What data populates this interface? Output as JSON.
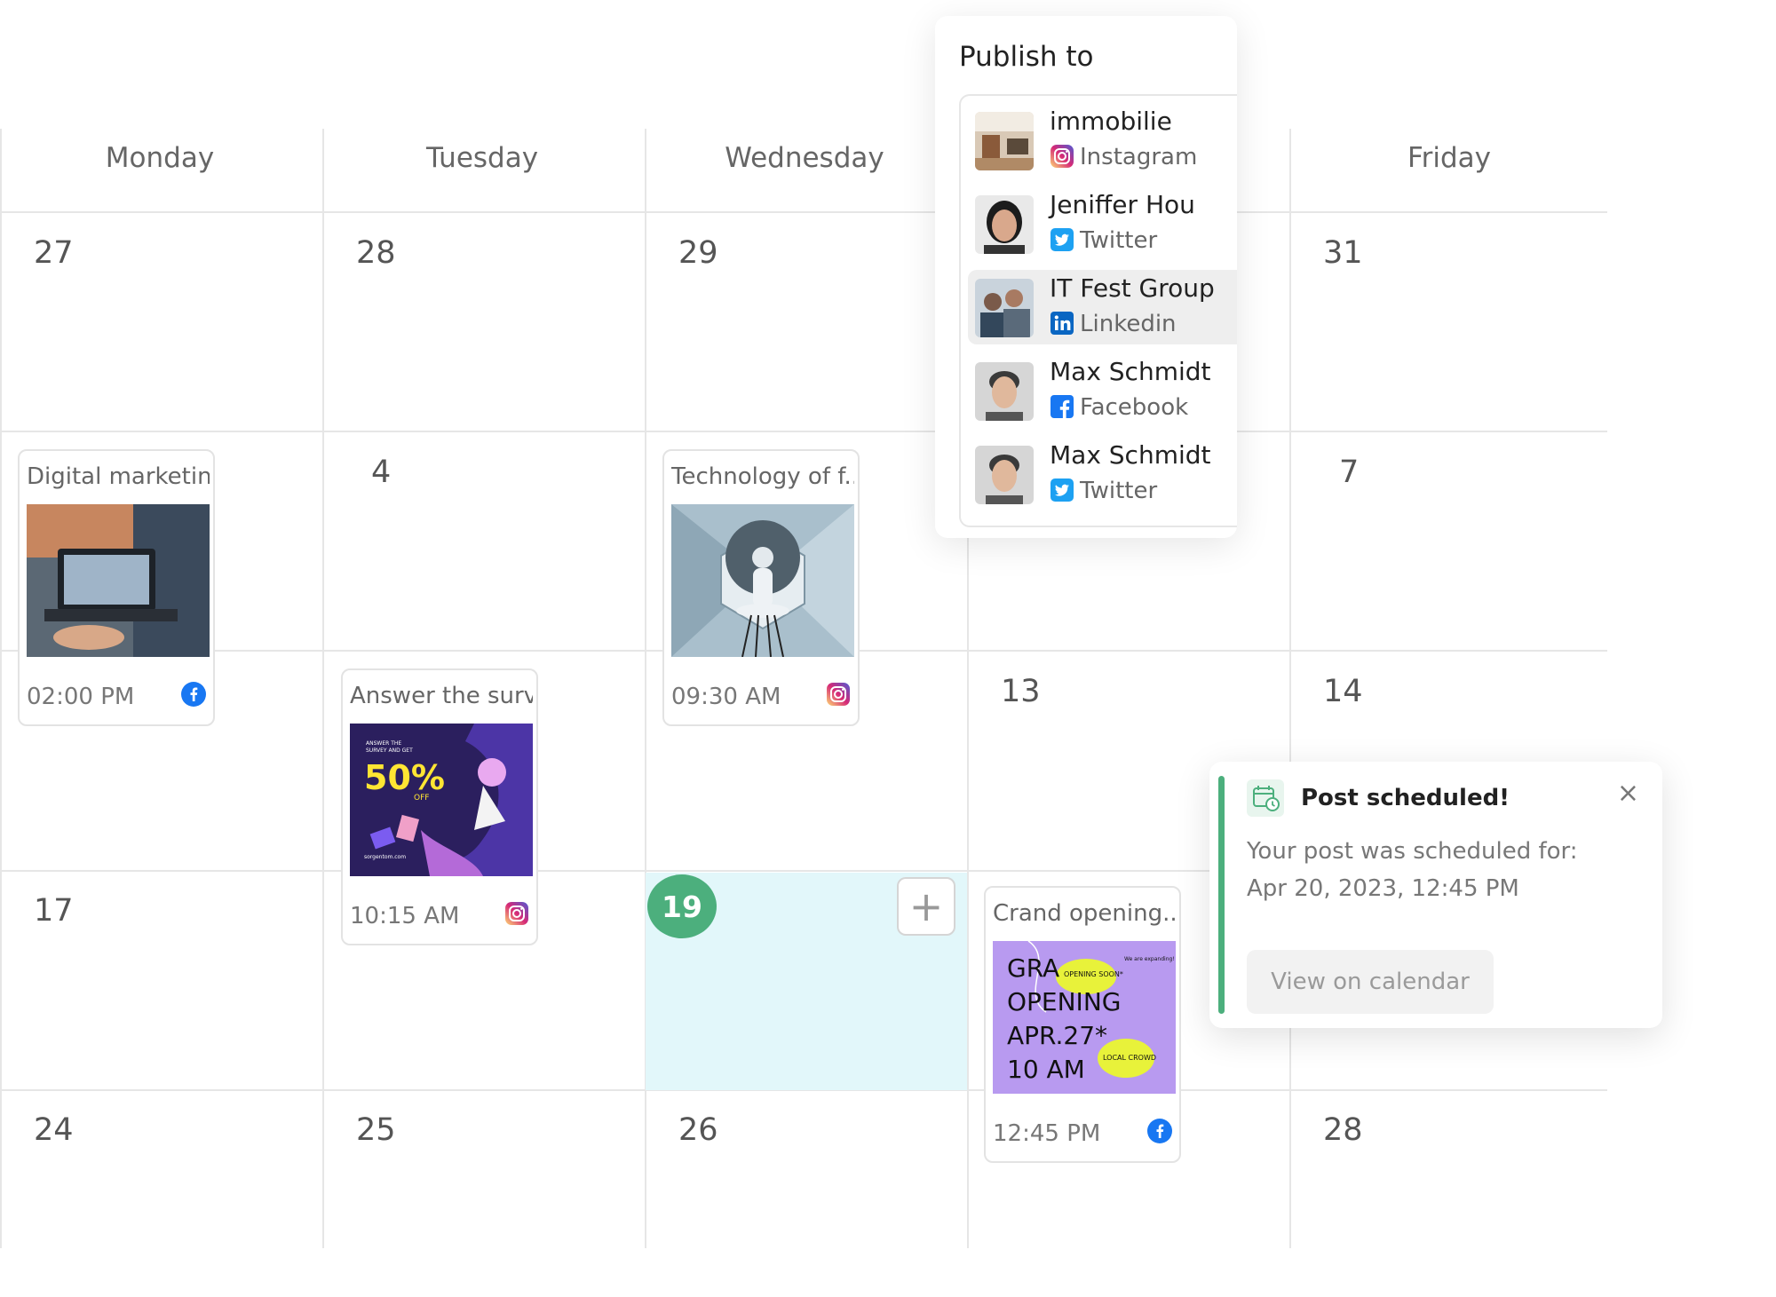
{
  "calendar": {
    "weekdays": [
      "Monday",
      "Tuesday",
      "Wednesday",
      "Friday"
    ],
    "dates": {
      "r1": [
        "27",
        "28",
        "29",
        "31"
      ],
      "r2": [
        "4",
        "7"
      ],
      "r3": [
        "13",
        "14"
      ],
      "r4": [
        "17",
        "19"
      ],
      "r5": [
        "24",
        "25",
        "26",
        "28"
      ]
    },
    "today": "19",
    "add_button": "+"
  },
  "posts": [
    {
      "title": "Digital marketin...",
      "time": "02:00 PM",
      "network_icon": "facebook-icon"
    },
    {
      "title": "Technology of f...",
      "time": "09:30 AM",
      "network_icon": "instagram-icon"
    },
    {
      "title": "Answer the surv...",
      "time": "10:15 AM",
      "network_icon": "instagram-icon",
      "image_text": {
        "line1": "ANSWER THE",
        "line2": "SURVEY AND GET",
        "pct": "50%",
        "off": "OFF",
        "site": "sorgentom.com"
      }
    },
    {
      "title": "Crand opening...",
      "time": "12:45 PM",
      "network_icon": "facebook-icon",
      "image_text": {
        "line1": "GRA",
        "line2": "OPENING",
        "line3": "APR.27*",
        "line4": "10 AM",
        "badge1": "OPENING SOON*",
        "badge2": "LOCAL CROWD",
        "corner": "We are expanding!"
      }
    }
  ],
  "publish_popup": {
    "title": "Publish to",
    "accounts": [
      {
        "name": "immobilie",
        "network": "Instagram"
      },
      {
        "name": "Jeniffer Hou",
        "network": "Twitter"
      },
      {
        "name": "IT Fest Group",
        "network": "Linkedin"
      },
      {
        "name": "Max Schmidt",
        "network": "Facebook"
      },
      {
        "name": "Max Schmidt",
        "network": "Twitter"
      }
    ]
  },
  "toast": {
    "title": "Post scheduled!",
    "line1": "Your post was scheduled for:",
    "line2": "Apr 20, 2023, 12:45 PM",
    "button": "View on calendar",
    "close": "×"
  },
  "colors": {
    "accent_green": "#4caf7d",
    "today_bg": "#e2f7fa",
    "facebook": "#1877f2",
    "twitter": "#1da1f2",
    "linkedin": "#0a66c2"
  }
}
